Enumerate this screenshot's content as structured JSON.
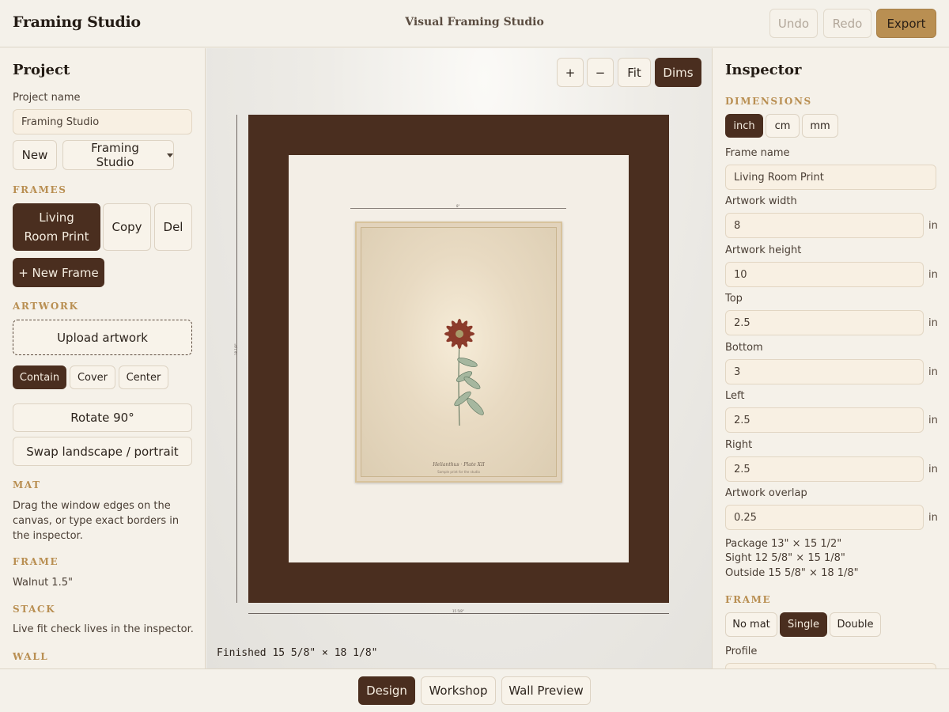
{
  "header": {
    "brand": "Framing Studio",
    "center_title": "Visual Framing Studio",
    "undo_label": "Undo",
    "redo_label": "Redo",
    "export_label": "Export"
  },
  "left": {
    "title": "Project",
    "project_name_label": "Project name",
    "project_name_value": "Framing Studio",
    "new_label": "New",
    "project_select_value": "Framing Studio",
    "frames_section": "FRAMES",
    "frame_items": [
      "Living Room Print"
    ],
    "copy_label": "Copy",
    "del_label": "Del",
    "new_frame_label": "+ New Frame",
    "artwork_section": "ARTWORK",
    "upload_label": "Upload artwork",
    "fit_modes": [
      "Contain",
      "Cover",
      "Center"
    ],
    "rotate_label": "Rotate 90°",
    "swap_label": "Swap landscape / portrait",
    "mat_section": "MAT",
    "mat_text": "Drag the window edges on the canvas, or type exact borders in the inspector.",
    "frame_section": "FRAME",
    "frame_text": "Walnut 1.5\"",
    "stack_section": "STACK",
    "stack_text": "Live fit check lives in the inspector.",
    "wall_section": "WALL"
  },
  "canvas": {
    "zoom_in": "+",
    "zoom_out": "−",
    "fit": "Fit",
    "dims": "Dims",
    "art_dim_label": "8\"",
    "height_dim_label": "18 1/8\"",
    "width_dim_label": "15 5/8\"",
    "plate_title": "Helianthus · Plate XII",
    "plate_subtitle": "Sample print for the studio",
    "finished_label": "Finished 15 5/8\" × 18 1/8\""
  },
  "inspector": {
    "title": "Inspector",
    "dimensions_section": "DIMENSIONS",
    "units": [
      "inch",
      "cm",
      "mm"
    ],
    "active_unit": "inch",
    "frame_name_label": "Frame name",
    "frame_name_value": "Living Room Print",
    "artwork_width_label": "Artwork width",
    "artwork_width_value": "8",
    "artwork_height_label": "Artwork height",
    "artwork_height_value": "10",
    "top_label": "Top",
    "top_value": "2.5",
    "bottom_label": "Bottom",
    "bottom_value": "3",
    "left_label": "Left",
    "left_value": "2.5",
    "right_label": "Right",
    "right_value": "2.5",
    "overlap_label": "Artwork overlap",
    "overlap_value": "0.25",
    "unit_suffix": "in",
    "package_line": "Package 13\" × 15 1/2\"",
    "sight_line": "Sight 12 5/8\" × 15 1/8\"",
    "outside_line": "Outside 15 5/8\" × 18 1/8\"",
    "frame_section": "FRAME",
    "mat_modes": [
      "No mat",
      "Single",
      "Double"
    ],
    "active_mat_mode": "Single",
    "profile_label": "Profile"
  },
  "bottom": {
    "tabs": [
      "Design",
      "Workshop",
      "Wall Preview"
    ],
    "active_tab": "Design"
  },
  "colors": {
    "frame": "#4a2e1f",
    "mat": "#f3eee6",
    "accent": "#b98f52"
  }
}
